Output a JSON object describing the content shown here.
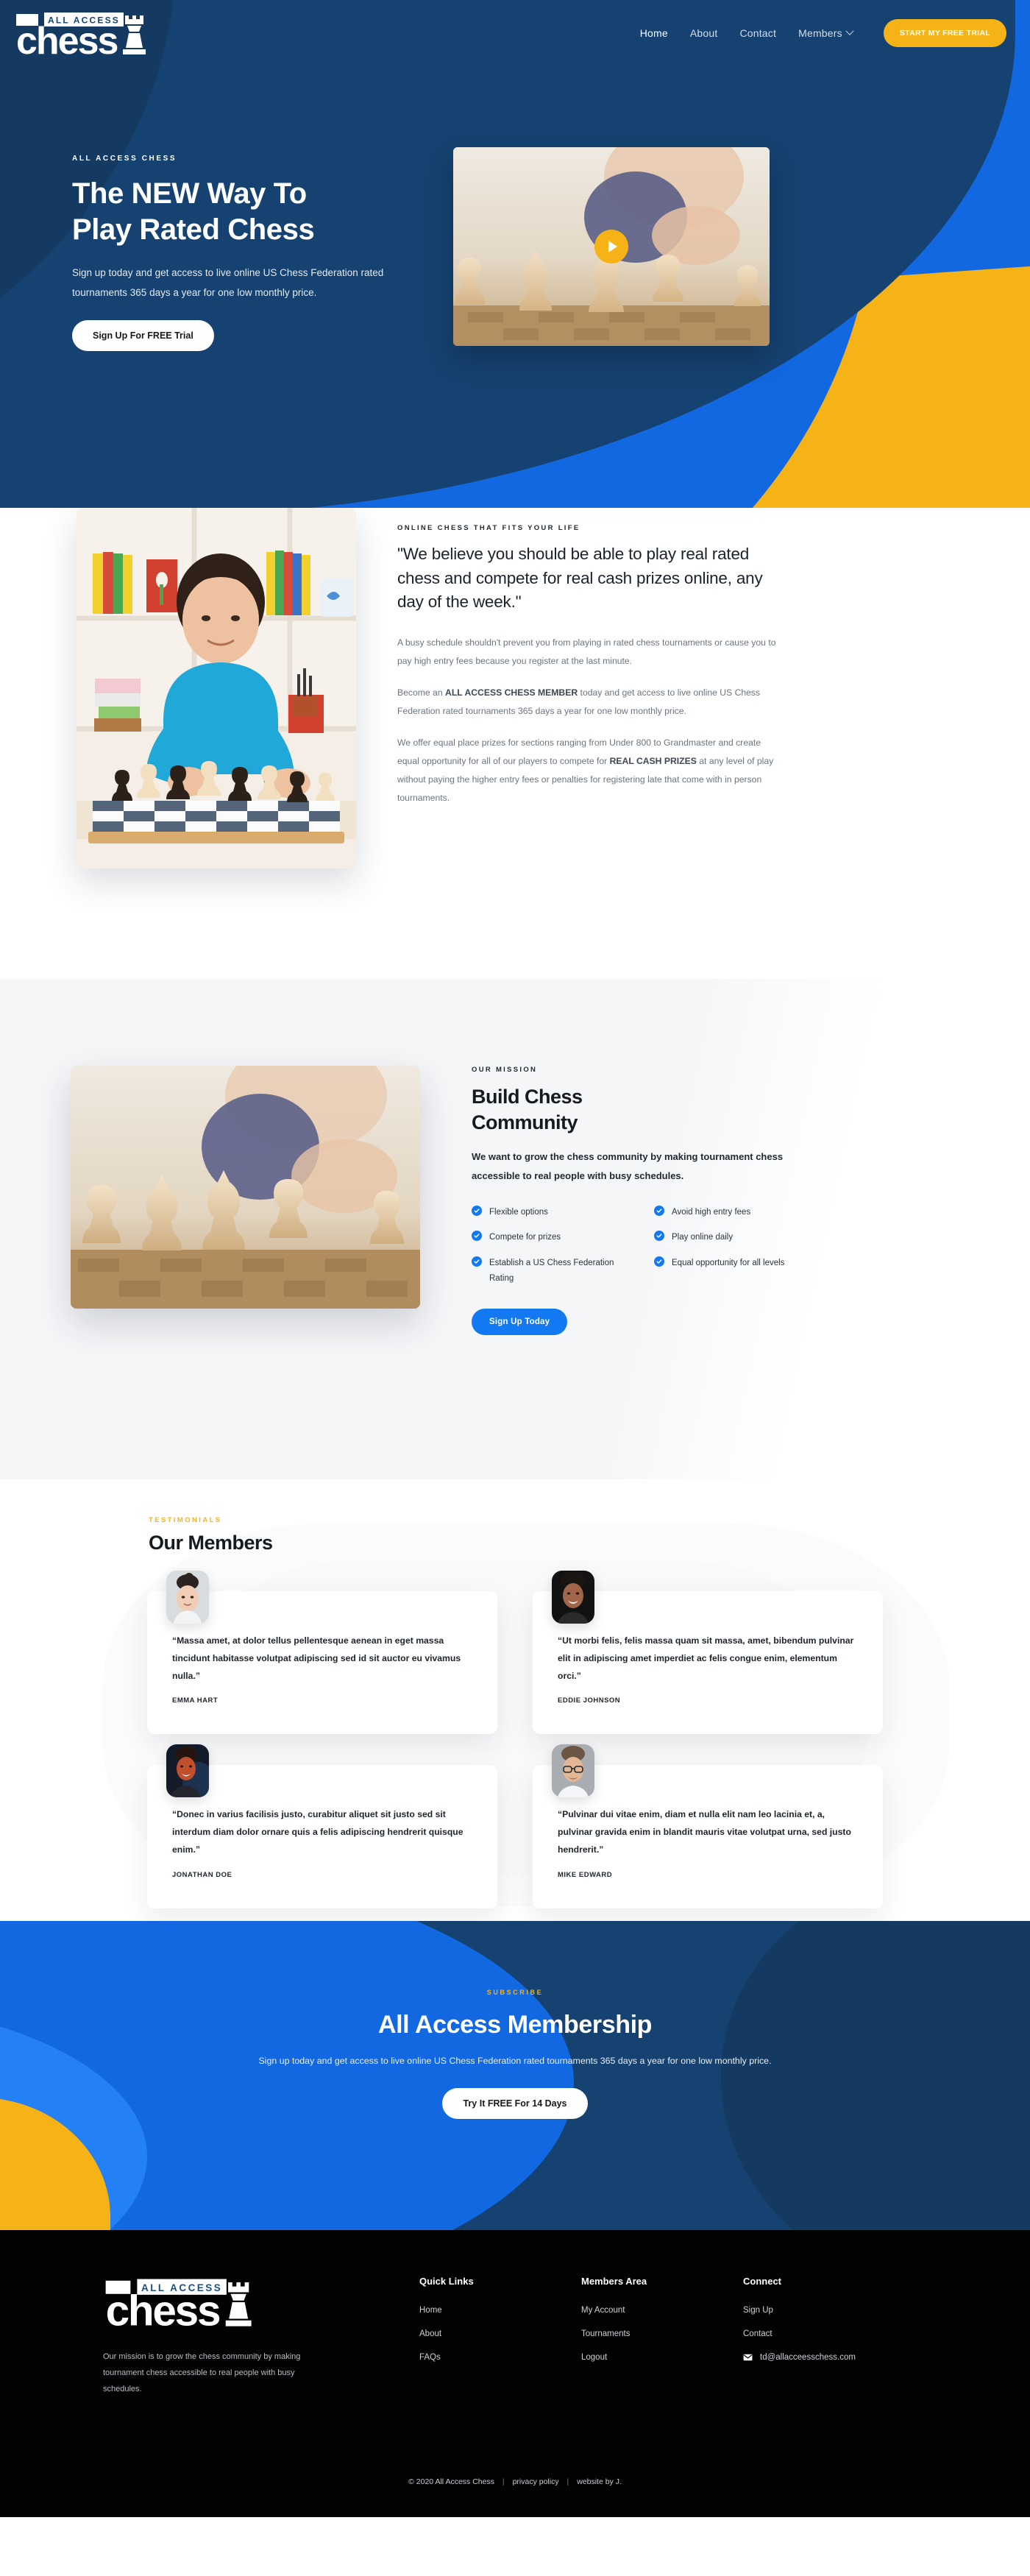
{
  "colors": {
    "navy_dark": "#143a62",
    "navy": "#154270",
    "blue": "#1268e0",
    "blue_bright": "#2380f5",
    "blue_accent": "#1279f2",
    "gold": "#f5b318",
    "gold_text": "#f0b323",
    "black": "#020202"
  },
  "nav": {
    "logo_word": "chess",
    "logo_tag": "ALL ACCESS",
    "links": [
      {
        "label": "Home",
        "active": true
      },
      {
        "label": "About",
        "active": false
      },
      {
        "label": "Contact",
        "active": false
      },
      {
        "label": "Members",
        "active": false,
        "has_caret": true
      }
    ],
    "cta_label": "START MY FREE TRIAL"
  },
  "hero": {
    "eyebrow": "ALL ACCESS CHESS",
    "title_line1": "The NEW Way To",
    "title_line2": "Play Rated Chess",
    "subtitle": "Sign up today and get access to live online US Chess Federation rated tournaments 365 days a year for one low monthly price.",
    "cta_label": "Sign Up For FREE Trial",
    "video_alt": "child-playing-chess-video-thumbnail",
    "play_icon": "play-icon"
  },
  "quote_section": {
    "photo_alt": "boy-playing-chess-at-desk",
    "eyebrow": "ONLINE CHESS THAT FITS YOUR LIFE",
    "headline": "\"We believe you should be able to play real rated chess and compete for real cash prizes online, any day of the week.\"",
    "paragraph1": "A busy schedule shouldn't prevent you from playing in rated chess tournaments or cause you to pay high entry fees because you register at the last minute.",
    "paragraph2_pre": "Become an ",
    "paragraph2_bold": "ALL ACCESS CHESS MEMBER",
    "paragraph2_post": " today and get access to live online US Chess Federation rated tournaments 365 days a year for one low monthly price.",
    "paragraph3_pre": "We offer equal place prizes for sections ranging from Under 800 to Grandmaster and create equal opportunity for all of our players to compete for ",
    "paragraph3_bold": "REAL CASH PRIZES",
    "paragraph3_post": " at any level of play without paying the higher entry fees or penalties for registering late that come with in person tournaments."
  },
  "mission": {
    "photo_alt": "chess-board-close-up",
    "eyebrow": "OUR MISSION",
    "title_line1": "Build Chess",
    "title_line2": "Community",
    "lead": "We want to grow the chess community by making tournament chess accessible to real people with busy schedules.",
    "features": [
      "Flexible options",
      "Avoid high entry fees",
      "Compete for prizes",
      "Play online daily",
      "Establish a US Chess Federation Rating",
      "Equal opportunity for all levels"
    ],
    "cta_label": "Sign Up Today"
  },
  "testimonials": {
    "eyebrow": "TESTIMONIALS",
    "title": "Our Members",
    "cards": [
      {
        "avatar_alt": "avatar-emma-hart",
        "quote": "“Massa amet, at dolor tellus pellentesque aenean in eget massa tincidunt habitasse volutpat adipiscing sed id sit auctor eu vivamus nulla.”",
        "name": "EMMA HART"
      },
      {
        "avatar_alt": "avatar-eddie-johnson",
        "quote": "“Ut morbi felis, felis massa quam sit massa, amet, bibendum pulvinar elit in adipiscing amet imperdiet ac felis congue enim, elementum orci.”",
        "name": "EDDIE JOHNSON"
      },
      {
        "avatar_alt": "avatar-jonathan-doe",
        "quote": "“Donec in varius facilisis justo, curabitur aliquet sit justo sed sit interdum diam dolor ornare quis a felis adipiscing hendrerit quisque enim.”",
        "name": "JONATHAN DOE"
      },
      {
        "avatar_alt": "avatar-mike-edward",
        "quote": "“Pulvinar dui vitae enim, diam et nulla elit nam leo lacinia et, a, pulvinar gravida enim in blandit mauris vitae volutpat urna, sed justo hendrerit.”",
        "name": "MIKE EDWARD"
      }
    ]
  },
  "subscribe": {
    "eyebrow": "SUBSCRIBE",
    "title": "All Access Membership",
    "text": "Sign up today and get access to live online US Chess Federation rated tournaments 365 days a year for one low monthly price.",
    "cta_label": "Try It FREE For 14 Days"
  },
  "footer": {
    "logo_word": "chess",
    "logo_tag": "ALL ACCESS",
    "about": "Our mission is to grow the chess community by making tournament chess accessible to real people with busy schedules.",
    "columns": [
      {
        "heading": "Quick Links",
        "links": [
          "Home",
          "About",
          "FAQs"
        ]
      },
      {
        "heading": "Members Area",
        "links": [
          "My Account",
          "Tournaments",
          "Logout"
        ]
      },
      {
        "heading": "Connect",
        "links": [
          "Sign Up",
          "Contact"
        ]
      }
    ],
    "email": "td@allacceesschess.com",
    "email_icon": "envelope-icon",
    "copyright": "© 2020 All Access Chess",
    "privacy_label": "privacy policy",
    "credit_label": "website by J."
  }
}
